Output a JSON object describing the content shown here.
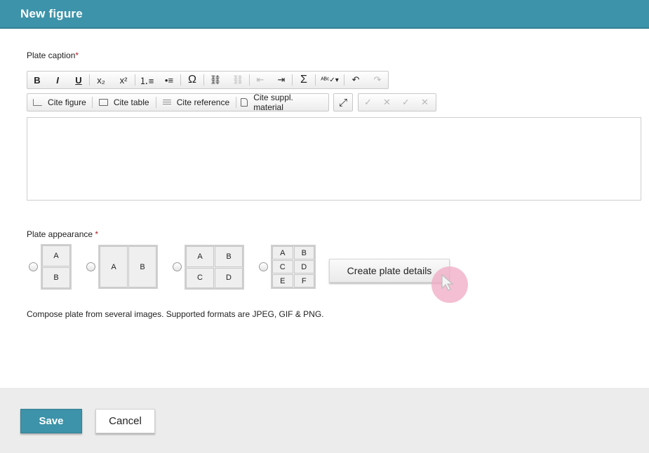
{
  "dialog": {
    "title": "New figure"
  },
  "caption": {
    "label": "Plate caption",
    "required_mark": "*",
    "toolbar_row1": [
      {
        "name": "bold-button",
        "glyph": "B",
        "disabled": false
      },
      {
        "name": "italic-button",
        "glyph": "I",
        "disabled": false
      },
      {
        "name": "underline-button",
        "glyph": "U",
        "disabled": false
      },
      {
        "name": "subscript-button",
        "glyph": "x₂",
        "disabled": false
      },
      {
        "name": "superscript-button",
        "glyph": "x²",
        "disabled": false
      },
      {
        "name": "numbered-list-button",
        "glyph": "⒈≡",
        "disabled": false
      },
      {
        "name": "bulleted-list-button",
        "glyph": "•≡",
        "disabled": false
      },
      {
        "name": "special-char-button",
        "glyph": "Ω",
        "disabled": false
      },
      {
        "name": "link-button",
        "glyph": "⛓",
        "disabled": false
      },
      {
        "name": "unlink-button",
        "glyph": "⛓",
        "disabled": true
      },
      {
        "name": "outdent-button",
        "glyph": "⇤",
        "disabled": true
      },
      {
        "name": "indent-button",
        "glyph": "⇥",
        "disabled": false
      },
      {
        "name": "math-button",
        "glyph": "Σ",
        "disabled": false
      },
      {
        "name": "spellcheck-button",
        "glyph": "ᴬᴮᶜ✓▾",
        "disabled": false
      },
      {
        "name": "undo-button",
        "glyph": "↶",
        "disabled": false
      },
      {
        "name": "redo-button",
        "glyph": "↷",
        "disabled": true
      }
    ],
    "cite_figure": "Cite figure",
    "cite_table": "Cite table",
    "cite_reference": "Cite reference",
    "cite_suppl": "Cite suppl. material",
    "maximize_icon": "⤢",
    "track_buttons": [
      "✓",
      "✕",
      "✓",
      "✕"
    ]
  },
  "appearance": {
    "label": "Plate appearance",
    "required_mark": "*",
    "layouts": [
      {
        "cells": [
          "A",
          "B"
        ]
      },
      {
        "cells": [
          "A",
          "B"
        ]
      },
      {
        "cells": [
          "A",
          "B",
          "C",
          "D"
        ]
      },
      {
        "cells": [
          "A",
          "B",
          "C",
          "D",
          "E",
          "F"
        ]
      }
    ],
    "create_button": "Create plate details"
  },
  "hint": "Compose plate from several images. Supported formats are JPEG, GIF & PNG.",
  "footer": {
    "save_label": "Save",
    "cancel_label": "Cancel"
  },
  "colors": {
    "accent": "#3d93a9",
    "required": "#b0202c",
    "cursor_highlight": "#f0aac3"
  }
}
